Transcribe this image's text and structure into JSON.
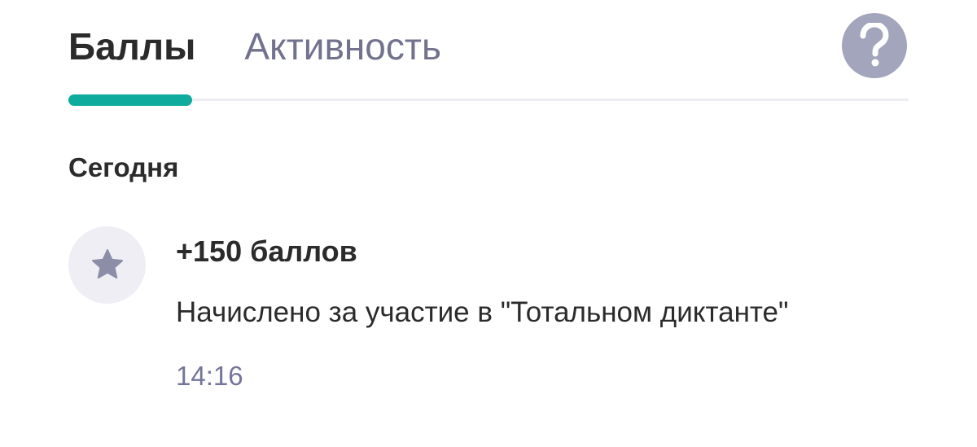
{
  "tabs": [
    {
      "label": "Баллы",
      "active": true
    },
    {
      "label": "Активность",
      "active": false
    }
  ],
  "help": {
    "icon": "question-icon",
    "color": "#a3a5bc"
  },
  "colors": {
    "accent": "#0fac9e",
    "text_primary": "#2b2b2b",
    "text_secondary": "#72728f",
    "icon_bg": "#eeeef4",
    "icon_fg": "#8c8ea8"
  },
  "section": {
    "title": "Сегодня",
    "items": [
      {
        "icon": "star-icon",
        "points": "+150 баллов",
        "description": "Начислено за участие в \"Тотальном диктанте\"",
        "time": "14:16"
      }
    ]
  }
}
